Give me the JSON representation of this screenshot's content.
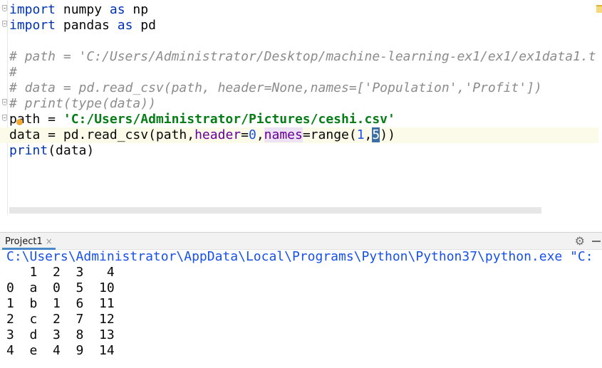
{
  "editor": {
    "lines": [
      {
        "segments": [
          {
            "t": "import",
            "c": "kw"
          },
          {
            "t": " numpy ",
            "c": "txt"
          },
          {
            "t": "as",
            "c": "kw"
          },
          {
            "t": " np",
            "c": "txt"
          }
        ]
      },
      {
        "segments": [
          {
            "t": "import",
            "c": "kw"
          },
          {
            "t": " pandas ",
            "c": "txt"
          },
          {
            "t": "as",
            "c": "kw"
          },
          {
            "t": " pd",
            "c": "txt"
          }
        ]
      },
      {
        "segments": []
      },
      {
        "segments": [
          {
            "t": "# path = 'C:/Users/Administrator/Desktop/machine-learning-ex1/ex1/ex1data1.t",
            "c": "cm"
          }
        ]
      },
      {
        "segments": [
          {
            "t": "#",
            "c": "cm"
          }
        ]
      },
      {
        "segments": [
          {
            "t": "# data = pd.read_csv(path, header=None,names=['Population','Profit'])",
            "c": "cm"
          }
        ]
      },
      {
        "segments": [
          {
            "t": "# print(type(data))",
            "c": "cm"
          }
        ]
      },
      {
        "segments": [
          {
            "t": "path = ",
            "c": "txt"
          },
          {
            "t": "'C:/Users/Administrator/Pictures/ceshi.csv'",
            "c": "str"
          }
        ]
      },
      {
        "segments": [
          {
            "t": "data = pd.read_csv(path,",
            "c": "txt"
          },
          {
            "t": "header",
            "c": "param"
          },
          {
            "t": "=",
            "c": "txt"
          },
          {
            "t": "0",
            "c": "num"
          },
          {
            "t": ",",
            "c": "txt"
          },
          {
            "t": "names",
            "c": "param-hl"
          },
          {
            "t": "=range(",
            "c": "txt"
          },
          {
            "t": "1",
            "c": "num"
          },
          {
            "t": ",",
            "c": "txt"
          },
          {
            "t": "5",
            "c": "caret-sel"
          },
          {
            "t": "))",
            "c": "txt"
          }
        ]
      },
      {
        "segments": [
          {
            "t": "print",
            "c": "kw"
          },
          {
            "t": "(data)",
            "c": "txt"
          }
        ]
      }
    ],
    "current_line": 8
  },
  "run_panel": {
    "tab_label": "Project1",
    "close_symbol": "×",
    "settings_icon": "gear-icon",
    "hide_icon": "minus-icon"
  },
  "console": {
    "command": "C:\\Users\\Administrator\\AppData\\Local\\Programs\\Python\\Python37\\python.exe \"C:",
    "rows": [
      "   1  2  3   4",
      "0  a  0  5  10",
      "1  b  1  6  11",
      "2  c  2  7  12",
      "3  d  3  8  13",
      "4  e  4  9  14"
    ]
  },
  "colors": {
    "keyword": "#0033b3",
    "comment": "#8c8c8c",
    "string": "#067d17",
    "number": "#1750eb",
    "parameter": "#660099",
    "current_line_bg": "#fcfae8",
    "tab_underline": "#4a88c7"
  }
}
